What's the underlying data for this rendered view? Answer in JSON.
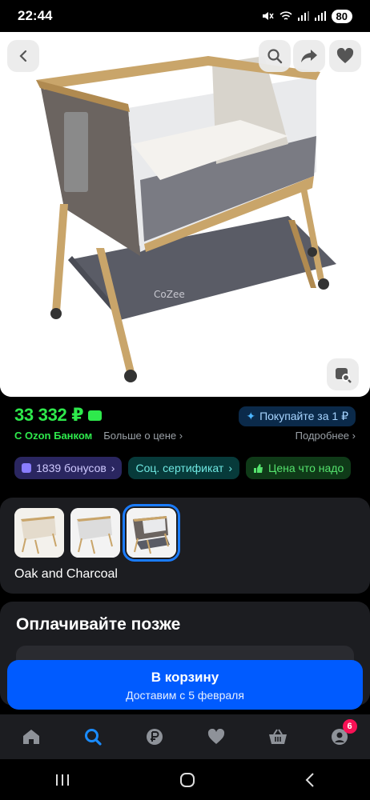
{
  "status_bar": {
    "time": "22:44",
    "battery": "80"
  },
  "product": {
    "price": "33 332 ₽",
    "promo_buy_for": "Покупайте за 1 ₽",
    "bank_label": "С Ozon Банком",
    "more_price": "Больше о цене",
    "details": "Подробнее"
  },
  "chips": [
    {
      "label": "1839 бонусов"
    },
    {
      "label": "Соц. сертификат"
    },
    {
      "label": "Цена что надо"
    }
  ],
  "variants": {
    "selected_name": "Oak and Charcoal"
  },
  "pay_later": {
    "title": "Оплачивайте позже"
  },
  "cart": {
    "label": "В корзину",
    "delivery": "Доставим с 5 февраля"
  },
  "tabbar": {
    "profile_badge": "6"
  },
  "colors": {
    "accent": "#005bff",
    "price_green": "#2ee94c",
    "badge": "#f91155"
  }
}
